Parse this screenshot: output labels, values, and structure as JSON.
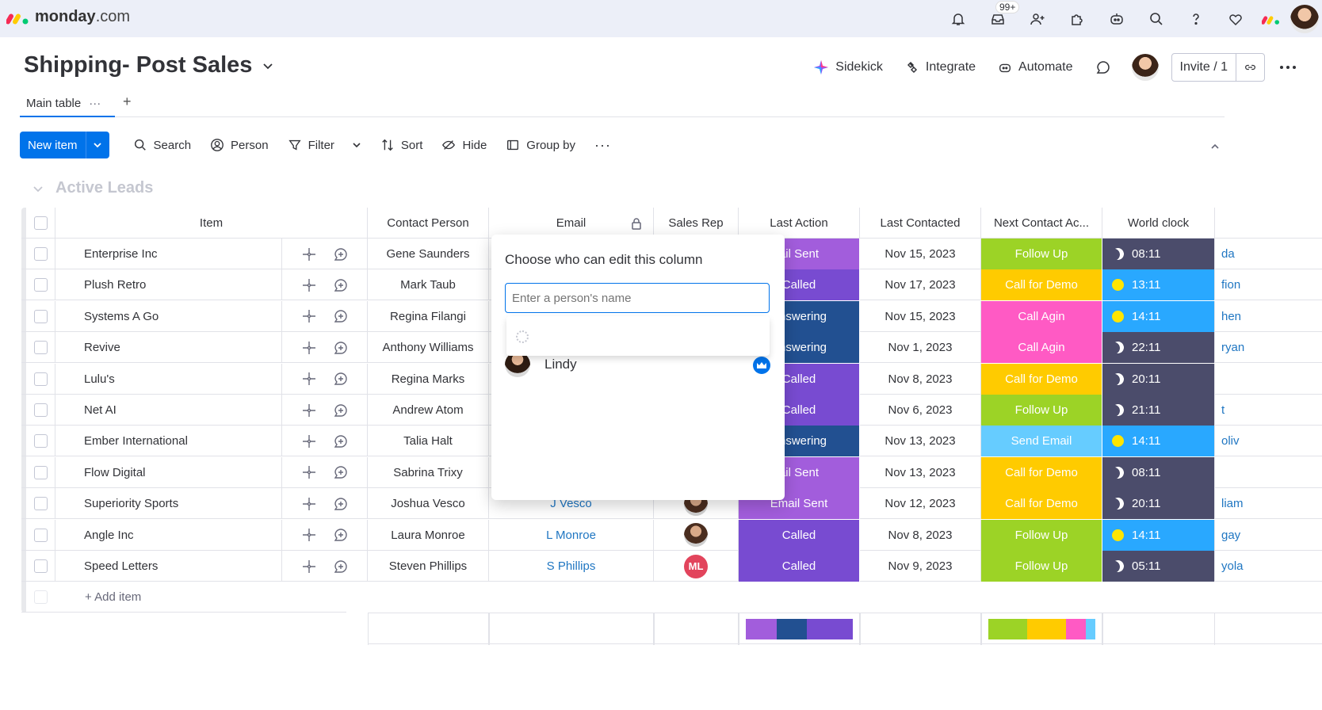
{
  "app": {
    "logo_bold": "monday",
    "logo_light": ".com",
    "notif_badge": "99+"
  },
  "board": {
    "title": "Shipping- Post Sales"
  },
  "header_actions": {
    "sidekick": "Sidekick",
    "integrate": "Integrate",
    "automate": "Automate",
    "invite": "Invite / 1"
  },
  "tabs": {
    "main": "Main table",
    "more": "···",
    "add": "+"
  },
  "toolbar": {
    "new_item": "New item",
    "search": "Search",
    "person": "Person",
    "filter": "Filter",
    "sort": "Sort",
    "hide": "Hide",
    "group_by": "Group by",
    "more": "···"
  },
  "group": {
    "title": "Active Leads"
  },
  "columns": {
    "item": "Item",
    "contact": "Contact Person",
    "email": "Email",
    "sales_rep": "Sales Rep",
    "last_action": "Last Action",
    "last_contacted": "Last Contacted",
    "next_contact": "Next Contact Ac...",
    "world_clock": "World clock"
  },
  "rows": [
    {
      "item": "Enterprise Inc",
      "contact": "Gene Saunders",
      "email": "",
      "action": "ail Sent",
      "action_color": "#a25ddc",
      "date": "Nov 15, 2023",
      "next": "Follow Up",
      "next_color": "#9cd326",
      "clock": "08:11",
      "night": true,
      "extra": "da"
    },
    {
      "item": "Plush Retro",
      "contact": "Mark Taub",
      "email": "",
      "action": "Called",
      "action_color": "#784bd1",
      "date": "Nov 17, 2023",
      "next": "Call for Demo",
      "next_color": "#ffcb00",
      "clock": "13:11",
      "night": false,
      "extra": "fion"
    },
    {
      "item": "Systems A Go",
      "contact": "Regina Filangi",
      "email": "",
      "action": "Answering",
      "action_color": "#225091",
      "date": "Nov 15, 2023",
      "next": "Call Agin",
      "next_color": "#ff5ac4",
      "clock": "14:11",
      "night": false,
      "extra": "hen"
    },
    {
      "item": "Revive",
      "contact": "Anthony Williams",
      "email": "",
      "action": "Answering",
      "action_color": "#225091",
      "date": "Nov 1, 2023",
      "next": "Call Agin",
      "next_color": "#ff5ac4",
      "clock": "22:11",
      "night": true,
      "extra": "ryan"
    },
    {
      "item": "Lulu's",
      "contact": "Regina Marks",
      "email": "",
      "action": "Called",
      "action_color": "#784bd1",
      "date": "Nov 8, 2023",
      "next": "Call for Demo",
      "next_color": "#ffcb00",
      "clock": "20:11",
      "night": true,
      "extra": ""
    },
    {
      "item": "Net AI",
      "contact": "Andrew Atom",
      "email": "",
      "action": "Called",
      "action_color": "#784bd1",
      "date": "Nov 6, 2023",
      "next": "Follow Up",
      "next_color": "#9cd326",
      "clock": "21:11",
      "night": true,
      "extra": "t"
    },
    {
      "item": "Ember International",
      "contact": "Talia Halt",
      "email": "",
      "action": "Answering",
      "action_color": "#225091",
      "date": "Nov 13, 2023",
      "next": "Send Email",
      "next_color": "#66ccff",
      "clock": "14:11",
      "night": false,
      "extra": "oliv"
    },
    {
      "item": "Flow Digital",
      "contact": "Sabrina Trixy",
      "email": "",
      "action": "ail Sent",
      "action_color": "#a25ddc",
      "date": "Nov 13, 2023",
      "next": "Call for Demo",
      "next_color": "#ffcb00",
      "clock": "08:11",
      "night": true,
      "extra": ""
    },
    {
      "item": "Superiority Sports",
      "contact": "Joshua Vesco",
      "email": "J Vesco",
      "action": "Email Sent",
      "action_color": "#a25ddc",
      "date": "Nov 12, 2023",
      "next": "Call for Demo",
      "next_color": "#ffcb00",
      "clock": "20:11",
      "night": true,
      "extra": "liam"
    },
    {
      "item": "Angle Inc",
      "contact": "Laura Monroe",
      "email": "L Monroe",
      "action": "Called",
      "action_color": "#784bd1",
      "date": "Nov 8, 2023",
      "next": "Follow Up",
      "next_color": "#9cd326",
      "clock": "14:11",
      "night": false,
      "extra": "gay"
    },
    {
      "item": "Speed Letters",
      "contact": "Steven Phillips",
      "email": "S Phillips",
      "action": "Called",
      "action_color": "#784bd1",
      "date": "Nov 9, 2023",
      "next": "Follow Up",
      "next_color": "#9cd326",
      "clock": "05:11",
      "night": true,
      "extra": "yola",
      "rep_initials": "ML"
    }
  ],
  "add_item": "+ Add item",
  "popup": {
    "title": "Choose who can edit this column",
    "placeholder": "Enter a person's name",
    "person_name": "Lindy"
  },
  "colors": {
    "primary": "#0073ea",
    "night_clock": "#4b4c6b",
    "day_clock": "#29a8ff"
  }
}
